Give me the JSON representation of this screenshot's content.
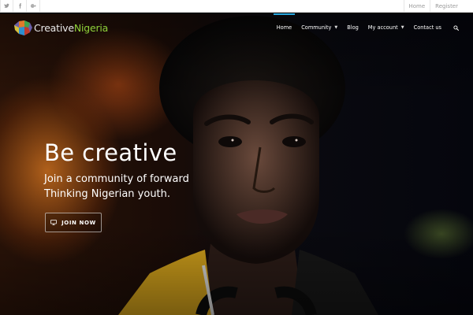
{
  "topbar": {
    "social": [
      {
        "icon": "twitter-icon",
        "glyph": "t"
      },
      {
        "icon": "facebook-icon",
        "glyph": "f"
      },
      {
        "icon": "google-plus-icon",
        "glyph": "g+"
      }
    ],
    "links": [
      {
        "label": "Home"
      },
      {
        "label": "Register"
      }
    ]
  },
  "header": {
    "logo_word1": "Creative",
    "logo_word2": "Nigeria",
    "nav": [
      {
        "label": "Home",
        "active": true
      },
      {
        "label": "Community",
        "dropdown": true
      },
      {
        "label": "Blog"
      },
      {
        "label": "My account",
        "dropdown": true
      },
      {
        "label": "Contact us"
      }
    ],
    "search_icon": "search-icon"
  },
  "hero": {
    "headline": "Be creative",
    "subline": "Join a community of forward Thinking Nigerian youth.",
    "cta_label": "JOIN NOW",
    "cta_icon": "monitor-icon"
  },
  "colors": {
    "accent": "#29a8e0",
    "logo_green": "#8fd13a",
    "topbar_bg": "#ffffff"
  }
}
